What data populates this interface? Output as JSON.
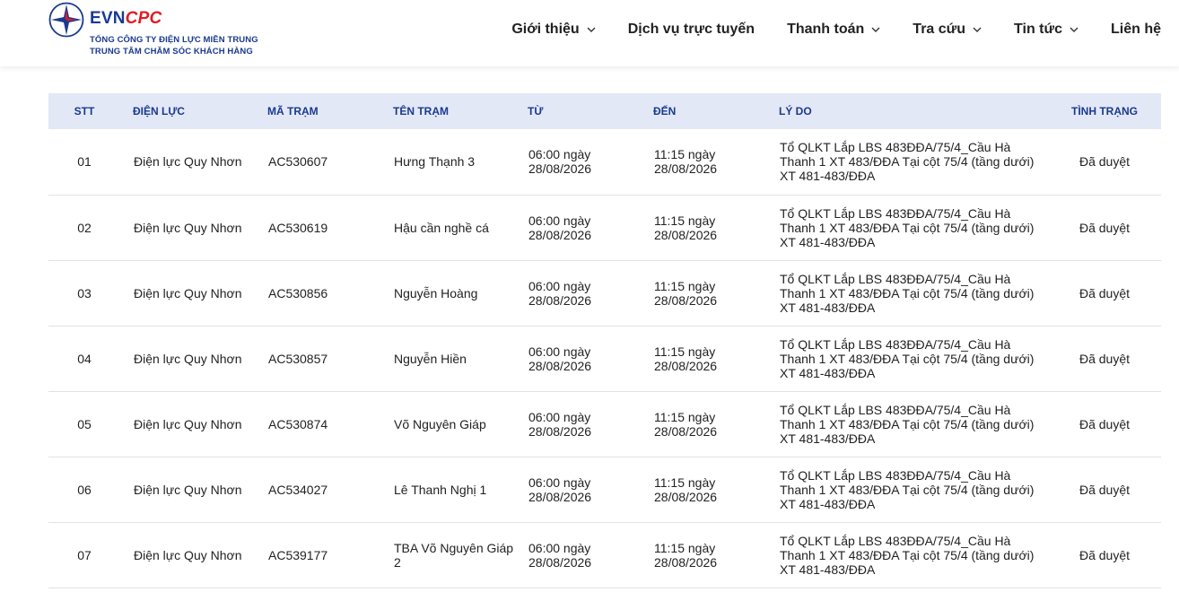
{
  "header": {
    "logo": {
      "evn": "EVN",
      "cpc": "CPC",
      "line1": "TỔNG CÔNG TY ĐIỆN LỰC MIỀN TRUNG",
      "line2": "TRUNG TÂM CHĂM SÓC KHÁCH HÀNG"
    },
    "nav": [
      {
        "label": "Giới thiệu",
        "dropdown": true
      },
      {
        "label": "Dịch vụ trực tuyến",
        "dropdown": false
      },
      {
        "label": "Thanh toán",
        "dropdown": true
      },
      {
        "label": "Tra cứu",
        "dropdown": true
      },
      {
        "label": "Tin tức",
        "dropdown": true
      },
      {
        "label": "Liên hệ",
        "dropdown": false
      }
    ]
  },
  "table": {
    "headers": [
      "STT",
      "ĐIỆN LỰC",
      "MÃ TRẠM",
      "TÊN TRẠM",
      "TỪ",
      "ĐẾN",
      "LÝ DO",
      "TÌNH TRẠNG"
    ],
    "rows": [
      {
        "stt": "01",
        "dien_luc": "Điện lực Quy Nhơn",
        "ma_tram": "AC530607",
        "ten_tram": "Hưng Thạnh 3",
        "tu": "06:00 ngày 28/08/2026",
        "den": "11:15 ngày 28/08/2026",
        "ly_do": "Tổ QLKT Lắp LBS 483ĐĐA/75/4_Cầu Hà Thanh 1 XT 483/ĐĐA Tại cột 75/4 (tầng dưới) XT 481-483/ĐĐA",
        "tinh_trang": "Đã duyệt"
      },
      {
        "stt": "02",
        "dien_luc": "Điện lực Quy Nhơn",
        "ma_tram": "AC530619",
        "ten_tram": "Hậu cần nghề cá",
        "tu": "06:00 ngày 28/08/2026",
        "den": "11:15 ngày 28/08/2026",
        "ly_do": "Tổ QLKT Lắp LBS 483ĐĐA/75/4_Cầu Hà Thanh 1 XT 483/ĐĐA Tại cột 75/4 (tầng dưới) XT 481-483/ĐĐA",
        "tinh_trang": "Đã duyệt"
      },
      {
        "stt": "03",
        "dien_luc": "Điện lực Quy Nhơn",
        "ma_tram": "AC530856",
        "ten_tram": "Nguyễn Hoàng",
        "tu": "06:00 ngày 28/08/2026",
        "den": "11:15 ngày 28/08/2026",
        "ly_do": "Tổ QLKT Lắp LBS 483ĐĐA/75/4_Cầu Hà Thanh 1 XT 483/ĐĐA Tại cột 75/4 (tầng dưới) XT 481-483/ĐĐA",
        "tinh_trang": "Đã duyệt"
      },
      {
        "stt": "04",
        "dien_luc": "Điện lực Quy Nhơn",
        "ma_tram": "AC530857",
        "ten_tram": "Nguyễn Hiền",
        "tu": "06:00 ngày 28/08/2026",
        "den": "11:15 ngày 28/08/2026",
        "ly_do": "Tổ QLKT Lắp LBS 483ĐĐA/75/4_Cầu Hà Thanh 1 XT 483/ĐĐA Tại cột 75/4 (tầng dưới) XT 481-483/ĐĐA",
        "tinh_trang": "Đã duyệt"
      },
      {
        "stt": "05",
        "dien_luc": "Điện lực Quy Nhơn",
        "ma_tram": "AC530874",
        "ten_tram": "Võ Nguyên Giáp",
        "tu": "06:00 ngày 28/08/2026",
        "den": "11:15 ngày 28/08/2026",
        "ly_do": "Tổ QLKT Lắp LBS 483ĐĐA/75/4_Cầu Hà Thanh 1 XT 483/ĐĐA Tại cột 75/4 (tầng dưới) XT 481-483/ĐĐA",
        "tinh_trang": "Đã duyệt"
      },
      {
        "stt": "06",
        "dien_luc": "Điện lực Quy Nhơn",
        "ma_tram": "AC534027",
        "ten_tram": "Lê Thanh Nghị 1",
        "tu": "06:00 ngày 28/08/2026",
        "den": "11:15 ngày 28/08/2026",
        "ly_do": "Tổ QLKT Lắp LBS 483ĐĐA/75/4_Cầu Hà Thanh 1 XT 483/ĐĐA Tại cột 75/4 (tầng dưới) XT 481-483/ĐĐA",
        "tinh_trang": "Đã duyệt"
      },
      {
        "stt": "07",
        "dien_luc": "Điện lực Quy Nhơn",
        "ma_tram": "AC539177",
        "ten_tram": "TBA Võ Nguyên Giáp 2",
        "tu": "06:00 ngày 28/08/2026",
        "den": "11:15 ngày 28/08/2026",
        "ly_do": "Tổ QLKT Lắp LBS 483ĐĐA/75/4_Cầu Hà Thanh 1 XT 483/ĐĐA Tại cột 75/4 (tầng dưới) XT 481-483/ĐĐA",
        "tinh_trang": "Đã duyệt"
      }
    ]
  },
  "colors": {
    "brand_blue": "#1a3a8f",
    "brand_red": "#e11b22",
    "header_row_bg": "#e3e8f7"
  }
}
